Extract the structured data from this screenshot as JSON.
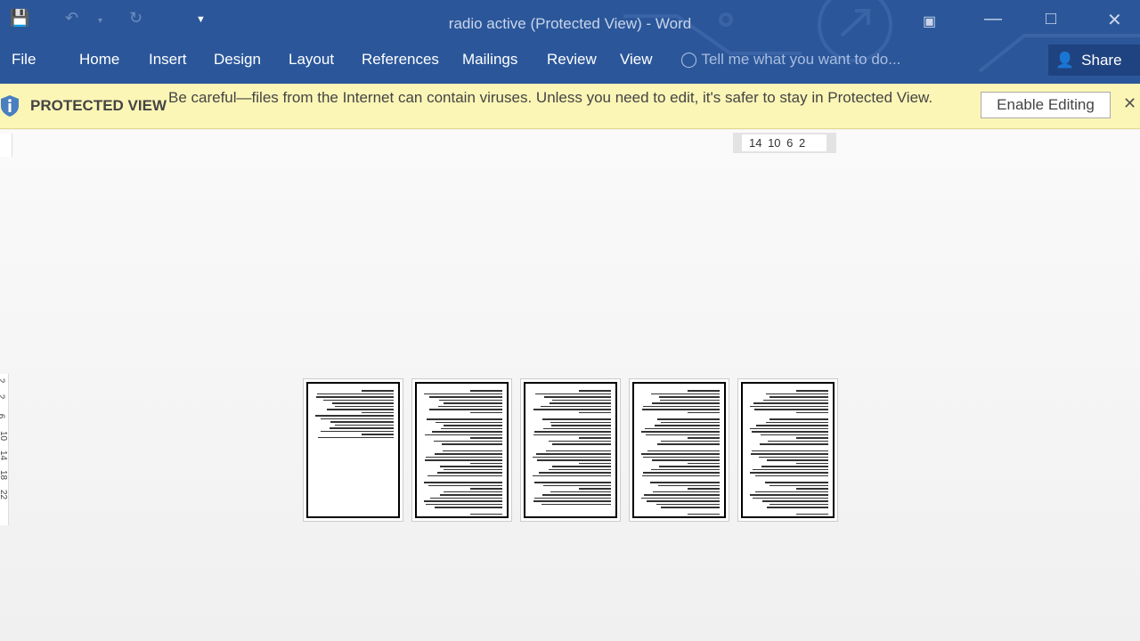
{
  "window": {
    "title": "radio active (Protected View) - Word"
  },
  "quick_access": {
    "icons": [
      "save-icon",
      "undo-icon",
      "redo-icon",
      "customize-icon"
    ]
  },
  "ribbon": {
    "tabs": [
      "File",
      "Home",
      "Insert",
      "Design",
      "Layout",
      "References",
      "Mailings",
      "Review",
      "View"
    ],
    "tell_me": "Tell me what you want to do...",
    "share": "Share"
  },
  "protected_view": {
    "title": "PROTECTED VIEW",
    "message": "Be careful—files from the Internet can contain viruses. Unless you need to edit, it's safer to stay in Protected View.",
    "enable_button": "Enable Editing"
  },
  "ruler": {
    "horizontal": "14 10 6 2",
    "vertical": [
      "2",
      "2",
      "6",
      "10",
      "14",
      "18",
      "22"
    ]
  },
  "document": {
    "page_count": 5
  },
  "colors": {
    "ribbon": "#2b579a",
    "protected_bar": "#fcf6b6"
  }
}
